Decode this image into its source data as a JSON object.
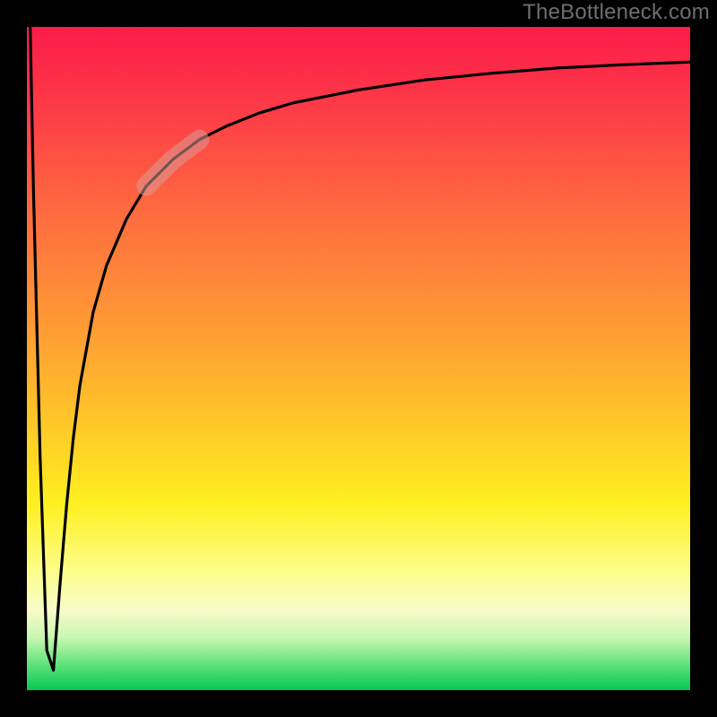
{
  "watermark": "TheBottleneck.com",
  "accent_colors": {
    "gradient_top": "#fc1b4a",
    "gradient_mid_orange": "#ff9a34",
    "gradient_yellow": "#fff020",
    "gradient_green": "#06c853",
    "curve": "#000000",
    "highlight_fill": "#d99a96",
    "highlight_opacity": 0.55
  },
  "chart_data": {
    "type": "line",
    "title": "",
    "xlabel": "",
    "ylabel": "",
    "xlim": [
      0,
      100
    ],
    "ylim": [
      0,
      100
    ],
    "grid": false,
    "series": [
      {
        "name": "bottleneck-curve",
        "x": [
          0.5,
          1,
          2,
          3,
          4,
          5,
          6,
          7,
          8,
          10,
          12,
          15,
          18,
          22,
          26,
          30,
          35,
          40,
          50,
          60,
          70,
          80,
          90,
          100
        ],
        "y": [
          100,
          75,
          35,
          6,
          3,
          16,
          28,
          38,
          46,
          57,
          64,
          71,
          76,
          80,
          83,
          85,
          87,
          88.5,
          90.5,
          92,
          93,
          93.8,
          94.3,
          94.7
        ]
      }
    ],
    "highlight_segment": {
      "series": "bottleneck-curve",
      "x_start": 18,
      "x_end": 26,
      "style": "thick-translucent"
    },
    "annotations": []
  }
}
